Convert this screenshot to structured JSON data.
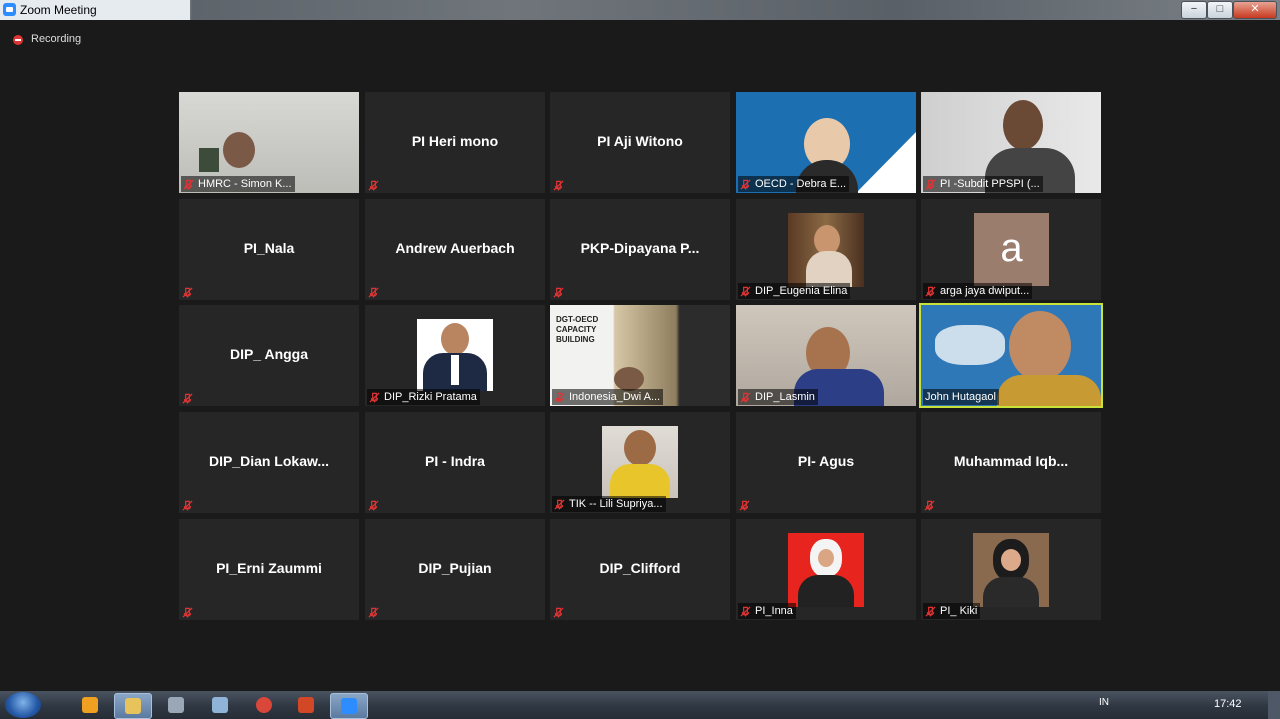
{
  "window": {
    "title": "Zoom Meeting",
    "minimize": "−",
    "maximize": "□",
    "close": "✕"
  },
  "recording": {
    "label": "Recording",
    "icon": "record-icon"
  },
  "participants": [
    {
      "name": "HMRC - Simon K...",
      "video": true,
      "muted": true
    },
    {
      "name": "PI Heri mono",
      "video": false,
      "muted": true
    },
    {
      "name": "PI Aji Witono",
      "video": false,
      "muted": true
    },
    {
      "name": "OECD - Debra E...",
      "video": true,
      "muted": true
    },
    {
      "name": "PI -Subdit PPSPI (...",
      "video": true,
      "muted": true
    },
    {
      "name": "PI_Nala",
      "video": false,
      "muted": true
    },
    {
      "name": "Andrew Auerbach",
      "video": false,
      "muted": true
    },
    {
      "name": "PKP-Dipayana  P...",
      "video": false,
      "muted": true
    },
    {
      "name": "DIP_Eugenia Elina",
      "video": true,
      "muted": true
    },
    {
      "name": "arga jaya dwiput...",
      "video": true,
      "muted": true,
      "avatar_letter": "a"
    },
    {
      "name": "DIP_ Angga",
      "video": false,
      "muted": true
    },
    {
      "name": "DIP_Rizki Pratama",
      "video": true,
      "muted": true
    },
    {
      "name": "Indonesia_Dwi A...",
      "video": true,
      "muted": true,
      "slide_text": "DGT-OECD CAPACITY BUILDING"
    },
    {
      "name": "DIP_Lasmin",
      "video": true,
      "muted": true
    },
    {
      "name": "John Hutagaol",
      "video": true,
      "muted": false,
      "active_speaker": true
    },
    {
      "name": "DIP_Dian  Lokaw...",
      "video": false,
      "muted": true
    },
    {
      "name": "PI - Indra",
      "video": false,
      "muted": true
    },
    {
      "name": "TIK -- Lili Supriya...",
      "video": true,
      "muted": true
    },
    {
      "name": "PI- Agus",
      "video": false,
      "muted": true
    },
    {
      "name": "Muhammad  Iqb...",
      "video": false,
      "muted": true
    },
    {
      "name": "PI_Erni Zaummi",
      "video": false,
      "muted": true
    },
    {
      "name": "DIP_Pujian",
      "video": false,
      "muted": true
    },
    {
      "name": "DIP_Clifford",
      "video": false,
      "muted": true
    },
    {
      "name": "PI_Inna",
      "video": true,
      "muted": true
    },
    {
      "name": "PI_ Kiki",
      "video": true,
      "muted": true
    }
  ],
  "taskbar": {
    "apps": [
      "media-player-icon",
      "file-explorer-icon",
      "tools-icon",
      "notes-icon",
      "chrome-icon",
      "powerpoint-icon",
      "zoom-icon"
    ],
    "language": "IN",
    "clock": "17:42"
  },
  "colors": {
    "background": "#1a1a1a",
    "tile": "#262626",
    "active_speaker_border": "#c9e23a",
    "muted_red": "#e03434"
  }
}
